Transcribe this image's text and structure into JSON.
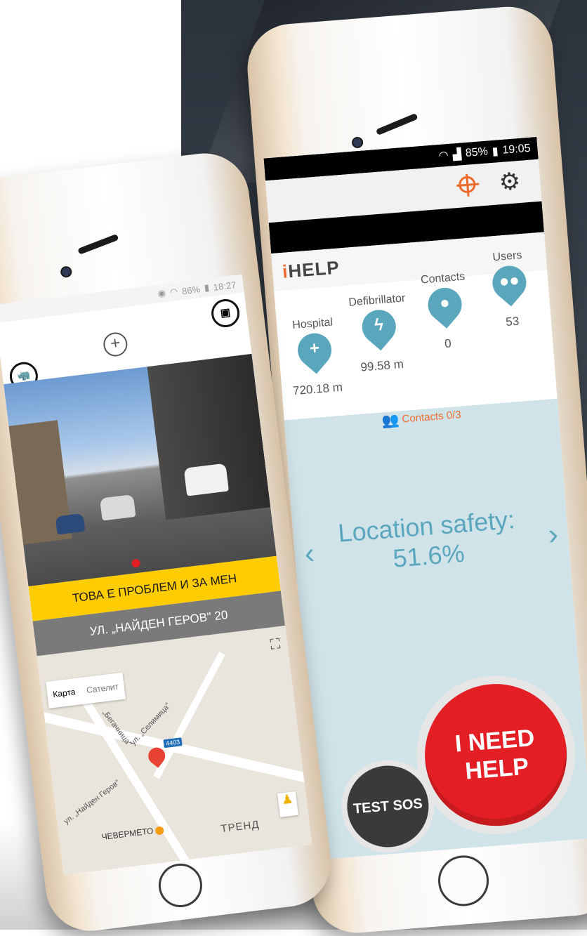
{
  "right_phone": {
    "status": {
      "battery": "85%",
      "time": "19:05"
    },
    "app_logo": "HELP",
    "stats": [
      {
        "label": "Hospital",
        "value": "720.18 m",
        "icon": "plus-pin-icon"
      },
      {
        "label": "Defibrillator",
        "value": "99.58 m",
        "icon": "bolt-pin-icon"
      },
      {
        "label": "Contacts",
        "value": "0",
        "icon": "person-pin-icon"
      },
      {
        "label": "Users",
        "value": "53",
        "icon": "group-pin-icon"
      }
    ],
    "contacts_summary": "Contacts  0/3",
    "safety_label": "Location safety:",
    "safety_value": "51.6%",
    "help_button": "I NEED HELP",
    "test_button": "TEST SOS",
    "colors": {
      "accent": "#ef6a2d",
      "teal": "#5aa6bd",
      "red": "#e31e24"
    }
  },
  "left_phone": {
    "status": {
      "battery": "86%",
      "time": "18:27"
    },
    "yellow_banner": "ТОВА Е ПРОБЛЕМ И ЗА МЕН",
    "address": "УЛ. „НАЙДЕН ГЕРОВ\" 20",
    "map": {
      "map_tab": "Карта",
      "satellite_tab": "Сателит",
      "street_1": "ул. „Найден Геров\"",
      "street_2": "ул. „Селимица\"",
      "street_3": "„Бегачница\"",
      "road_badge": "4403",
      "poi": "ЧЕВЕРМЕТО",
      "area": "ТРЕНД"
    },
    "colors": {
      "yellow": "#ffcc00",
      "gray": "#7a7a7a"
    }
  }
}
